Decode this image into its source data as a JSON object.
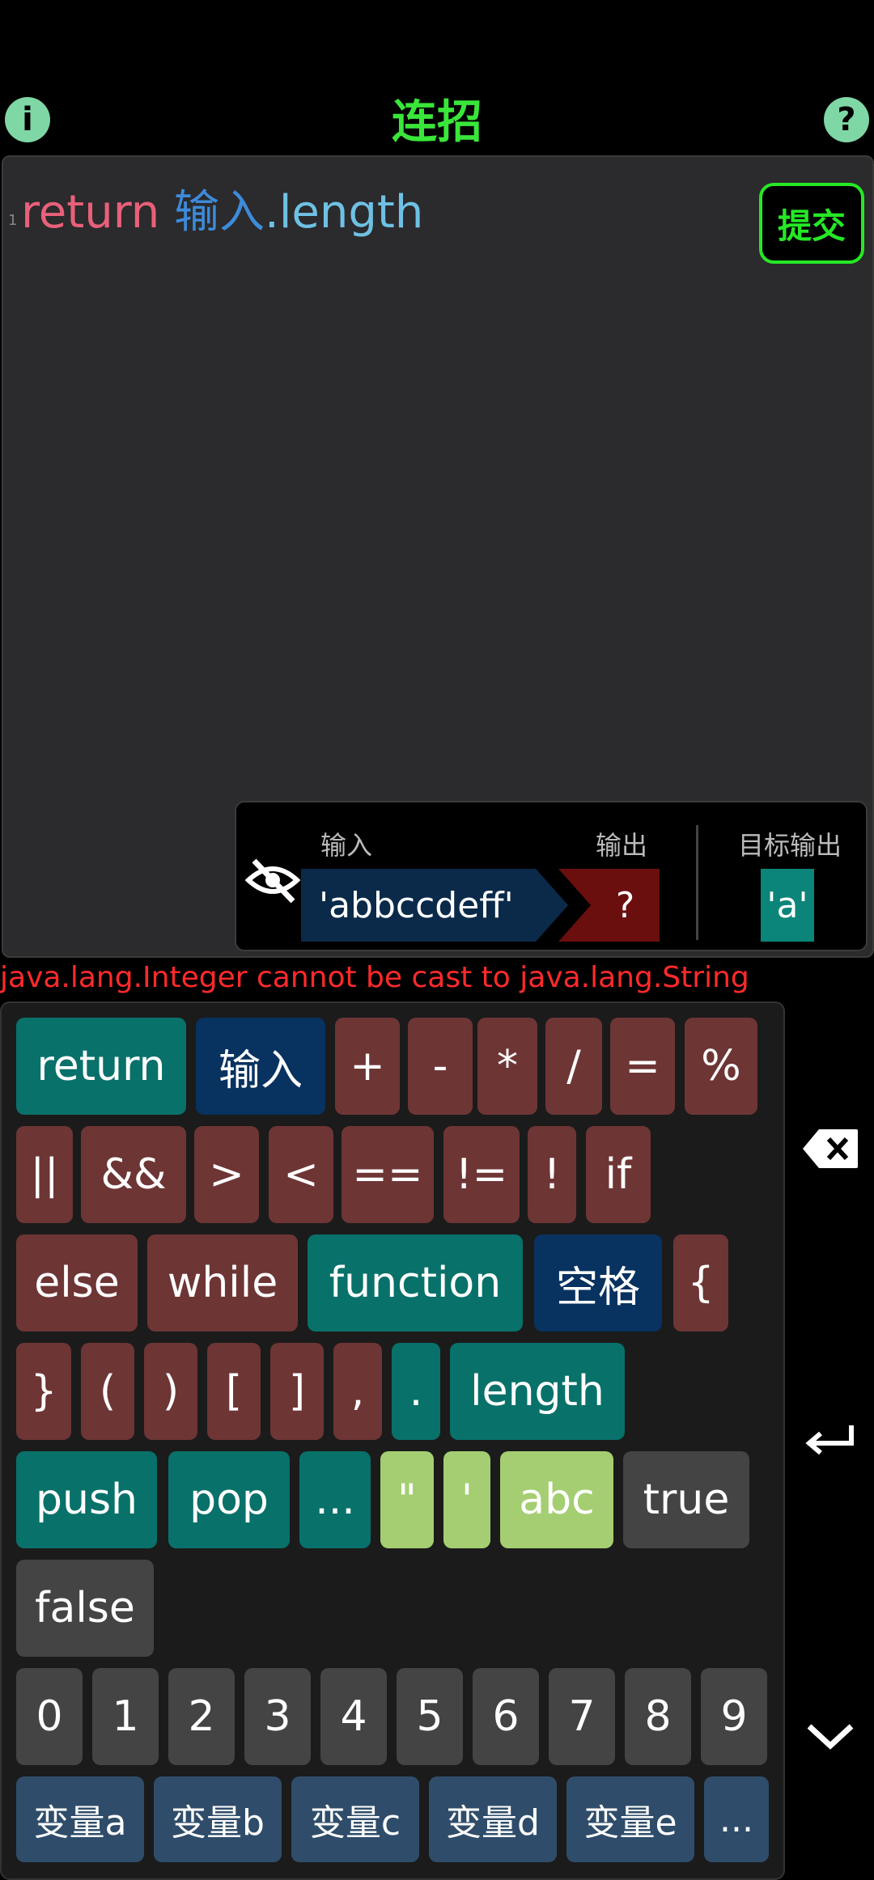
{
  "header": {
    "title": "连招",
    "info_icon": "info-icon",
    "help_icon": "help-icon"
  },
  "editor": {
    "line_number": "1",
    "tokens": {
      "kw": "return",
      "space": " ",
      "var": "输入",
      "dot": ".",
      "prop": "length"
    },
    "submit_label": "提交"
  },
  "io": {
    "input_label": "输入",
    "output_label": "输出",
    "target_label": "目标输出",
    "input_value": "'abbccdeff'",
    "output_value": "?",
    "target_value": "'a'",
    "hide_icon": "eye-off-icon"
  },
  "error_message": "java.lang.Integer cannot be cast to java.lang.String",
  "keyboard": {
    "row1": [
      "return",
      "输入",
      "+",
      "-",
      "*",
      "/",
      "=",
      "%"
    ],
    "row2": [
      "||",
      "&&",
      ">",
      "<",
      "==",
      "!=",
      "!",
      "if"
    ],
    "row3": [
      "else",
      "while",
      "function",
      "空格",
      "{"
    ],
    "row4": [
      "}",
      "(",
      ")",
      "[",
      "]",
      ",",
      ".",
      "length"
    ],
    "row5": [
      "push",
      "pop",
      "...",
      "\"",
      "'",
      "abc",
      "true"
    ],
    "row6": [
      "false"
    ],
    "digits": [
      "0",
      "1",
      "2",
      "3",
      "4",
      "5",
      "6",
      "7",
      "8",
      "9"
    ],
    "vars": [
      "变量a",
      "变量b",
      "变量c",
      "变量d",
      "变量e",
      "..."
    ]
  },
  "side_controls": {
    "backspace": "backspace-icon",
    "enter": "enter-icon",
    "collapse": "chevron-down-icon"
  }
}
